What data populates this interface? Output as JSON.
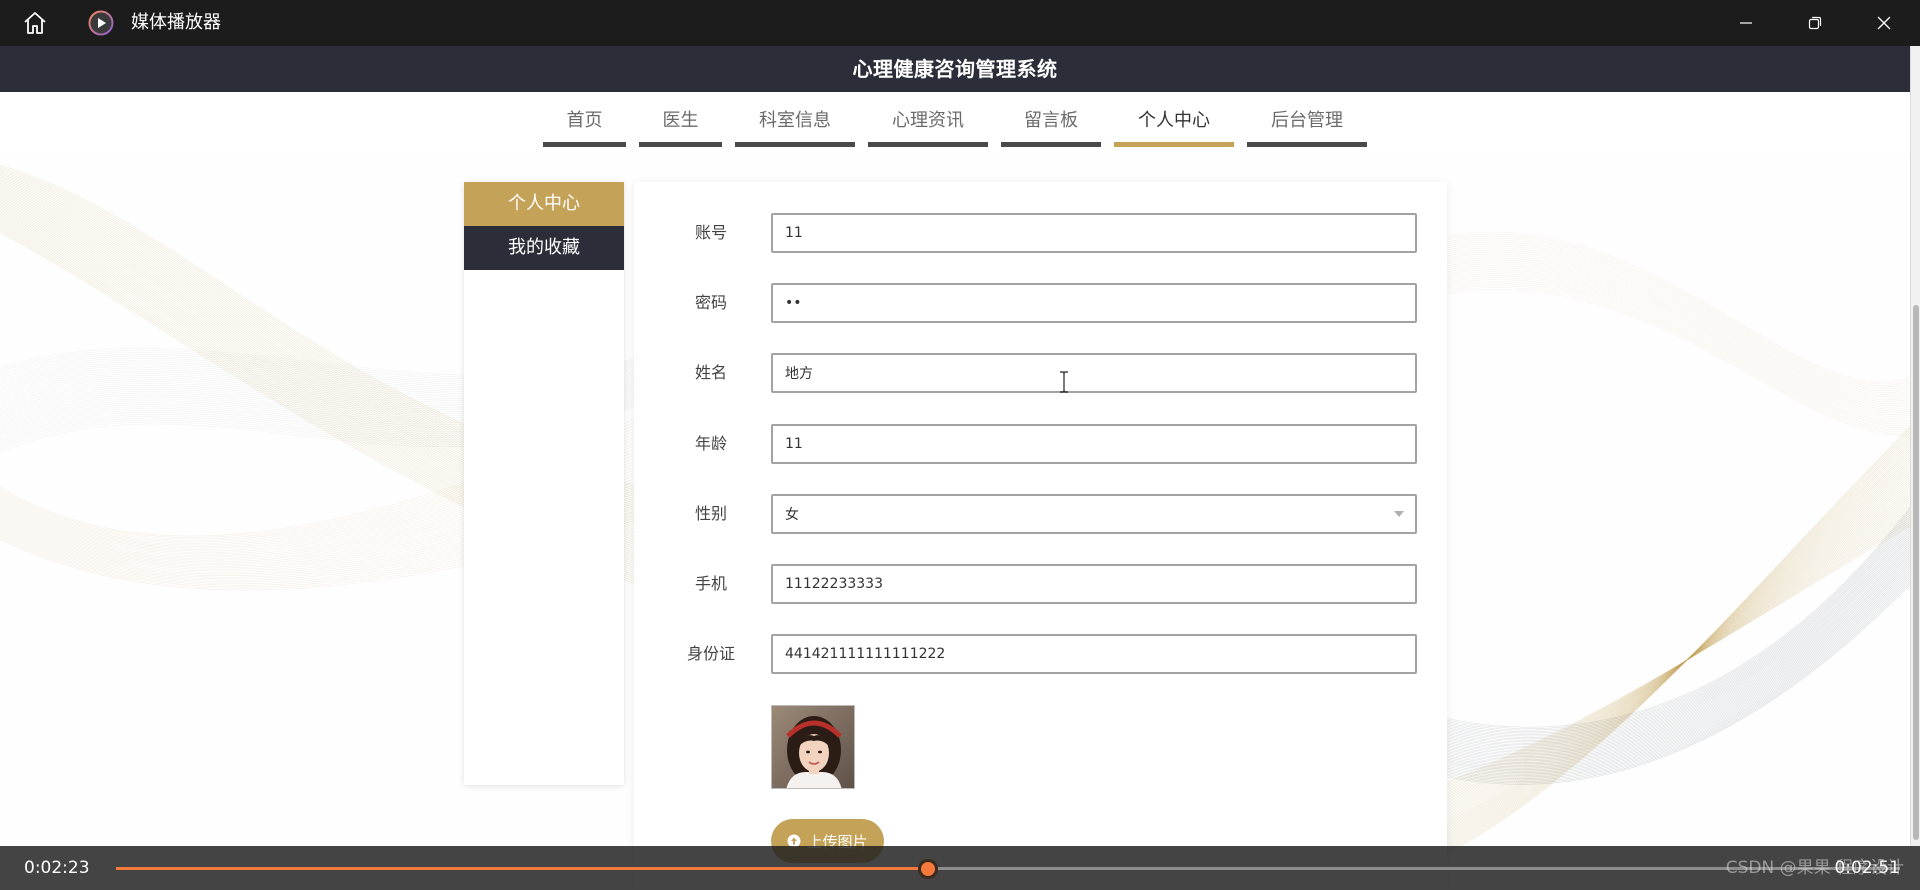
{
  "player": {
    "app_title": "媒体播放器",
    "current_time": "0:02:23",
    "remaining_time": "0:02:51",
    "progress": 0.455,
    "watermark": "CSDN @果果 程序设计"
  },
  "site": {
    "title": "心理健康咨询管理系统"
  },
  "nav": {
    "active_index": 5,
    "items": [
      {
        "label": "首页"
      },
      {
        "label": "医生"
      },
      {
        "label": "科室信息"
      },
      {
        "label": "心理资讯"
      },
      {
        "label": "留言板"
      },
      {
        "label": "个人中心"
      },
      {
        "label": "后台管理"
      }
    ]
  },
  "sidebar": {
    "items": [
      {
        "label": "个人中心",
        "active": true
      },
      {
        "label": "我的收藏",
        "active": false
      }
    ]
  },
  "form": {
    "fields": [
      {
        "label": "账号",
        "value": "11"
      },
      {
        "label": "密码",
        "value": "••"
      },
      {
        "label": "姓名",
        "value": "地方"
      },
      {
        "label": "年龄",
        "value": "11"
      },
      {
        "label": "性别",
        "value": "女"
      },
      {
        "label": "手机",
        "value": "11122233333"
      },
      {
        "label": "身份证",
        "value": "441421111111111222"
      }
    ],
    "upload_label": "上传图片"
  },
  "icons": {
    "home": "home-icon",
    "app": "play-icon",
    "minimize": "minimize-icon",
    "restore": "restore-icon",
    "close": "close-icon",
    "select_caret": "chevron-down-icon",
    "upload": "upload-icon",
    "cursor": "text-cursor-icon"
  },
  "colors": {
    "gold": "#c4a257",
    "navy": "#2b2e38",
    "accent": "#f5793a",
    "titlebar": "#1c1c1c"
  }
}
